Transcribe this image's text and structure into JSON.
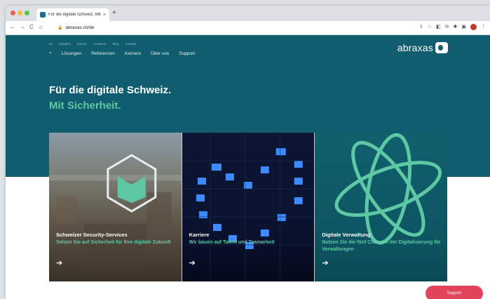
{
  "browser": {
    "tab_title": "Für die digitale Schweiz. Mit Si...",
    "tab_close": "×",
    "new_tab": "+",
    "url": "abraxas.ch/de",
    "nav_back": "←",
    "nav_forward": "→",
    "nav_reload": "C",
    "nav_home": "⌂"
  },
  "site": {
    "lang": "de",
    "top_links": [
      "Magazin",
      "Events",
      "Academy",
      "Blog",
      "Kontakt"
    ],
    "nav": [
      "Lösungen",
      "Referenzen",
      "Karriere",
      "Über uns",
      "Support"
    ],
    "logo_text": "abraxas",
    "headline": "Für die digitale Schweiz.",
    "subline": "Mit Sicherheit.",
    "cards": [
      {
        "title": "Schweizer Security-Services",
        "text": "Setzen Sie auf Sicherheit für Ihre digitale Zukunft",
        "arrow": "➔"
      },
      {
        "title": "Karriere",
        "text": "Wir bauen auf Talent und Teamarbeit",
        "arrow": "➔"
      },
      {
        "title": "Digitale Verwaltung",
        "text": "Nutzen Sie die fünf Chancen der Digitalisierung für Verwaltungen",
        "arrow": "➔"
      }
    ],
    "support_button": "Support"
  },
  "colors": {
    "hero": "#0f5d6e",
    "accent": "#5ec7a4",
    "support": "#e0435a"
  }
}
